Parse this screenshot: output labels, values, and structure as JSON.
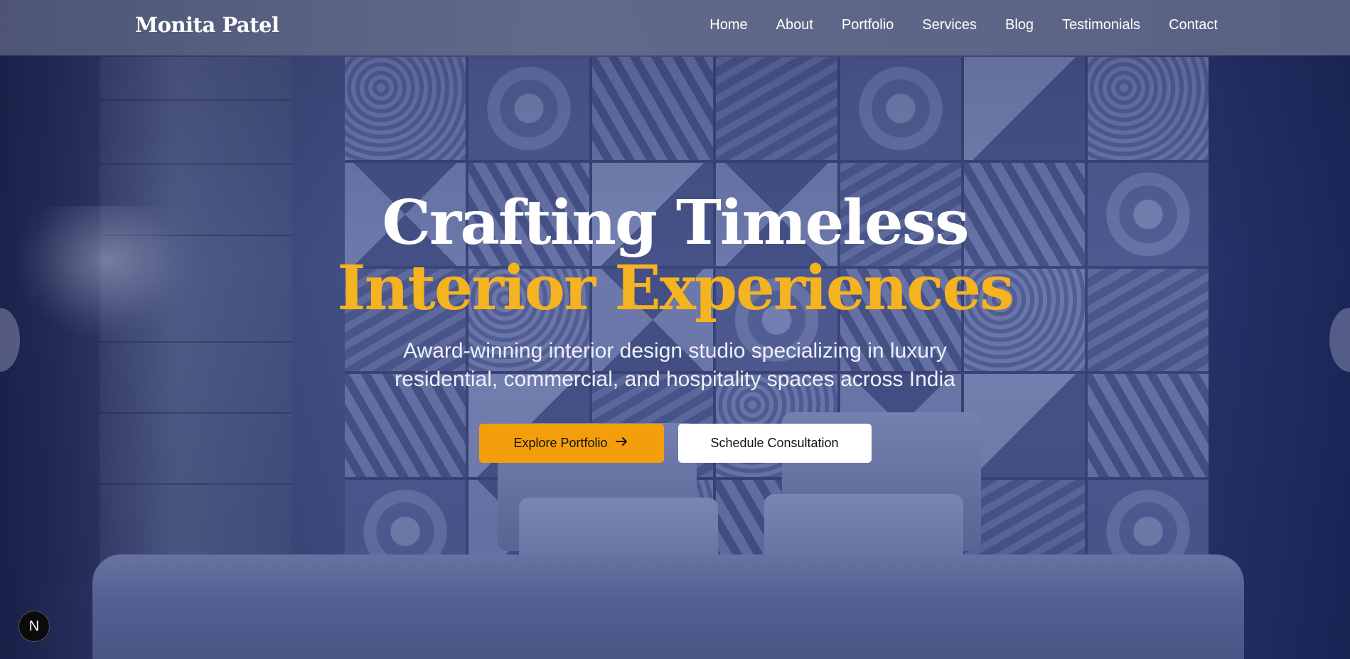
{
  "brand": "Monita Patel",
  "nav": [
    "Home",
    "About",
    "Portfolio",
    "Services",
    "Blog",
    "Testimonials",
    "Contact"
  ],
  "hero": {
    "title_line1": "Crafting Timeless",
    "title_line2": "Interior Experiences",
    "subtitle": "Award-winning interior design studio specializing in luxury residential, commercial, and hospitality spaces across India",
    "primary_cta": "Explore Portfolio",
    "secondary_cta": "Schedule Consultation"
  },
  "icons": {
    "arrow": "arrow-right-icon",
    "framework_badge": "N"
  },
  "colors": {
    "accent": "#f5b320",
    "button_primary": "#f59e0b",
    "overlay": "#3b4780"
  }
}
